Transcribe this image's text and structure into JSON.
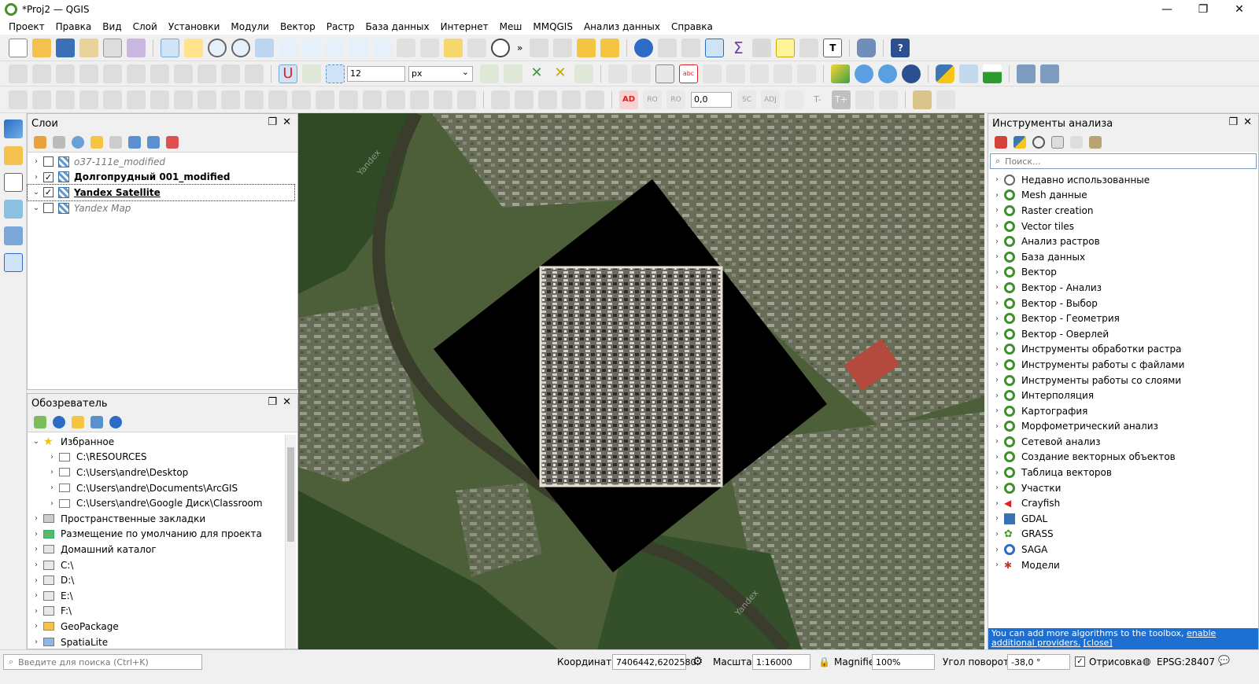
{
  "window": {
    "title": "*Proj2 — QGIS"
  },
  "menu": [
    "Проект",
    "Правка",
    "Вид",
    "Слой",
    "Установки",
    "Модули",
    "Вектор",
    "Растр",
    "База данных",
    "Интернет",
    "Меш",
    "MMQGIS",
    "Анализ данных",
    "Справка"
  ],
  "toolbar": {
    "snap_tolerance": "12",
    "snap_units": "px",
    "label_offset": "0,0"
  },
  "layers_panel": {
    "title": "Слои",
    "layers": [
      {
        "name": "o37-111e_modified",
        "checked": false,
        "expanded": false,
        "style": "italic-gray"
      },
      {
        "name": "Долгопрудный 001_modified",
        "checked": true,
        "expanded": false,
        "style": "bold"
      },
      {
        "name": "Yandex Satellite",
        "checked": true,
        "expanded": true,
        "style": "bold-underline"
      },
      {
        "name": "Yandex Map",
        "checked": false,
        "expanded": true,
        "style": "italic-gray"
      }
    ]
  },
  "browser_panel": {
    "title": "Обозреватель",
    "items": [
      {
        "label": "Избранное",
        "level": 0,
        "icon": "star-icon",
        "open": true
      },
      {
        "label": "C:\\RESOURCES",
        "level": 1,
        "icon": "folder-icon"
      },
      {
        "label": "C:\\Users\\andre\\Desktop",
        "level": 1,
        "icon": "folder-icon"
      },
      {
        "label": "C:\\Users\\andre\\Documents\\ArcGIS",
        "level": 1,
        "icon": "folder-icon"
      },
      {
        "label": "C:\\Users\\andre\\Google Диск\\Classroom",
        "level": 1,
        "icon": "folder-icon"
      },
      {
        "label": "Пространственные закладки",
        "level": 0,
        "icon": "bookmark-icon"
      },
      {
        "label": "Размещение по умолчанию для проекта",
        "level": 0,
        "icon": "project-home-icon"
      },
      {
        "label": "Домашний каталог",
        "level": 0,
        "icon": "home-icon"
      },
      {
        "label": "C:\\",
        "level": 0,
        "icon": "drive-icon"
      },
      {
        "label": "D:\\",
        "level": 0,
        "icon": "drive-icon"
      },
      {
        "label": "E:\\",
        "level": 0,
        "icon": "drive-icon"
      },
      {
        "label": "F:\\",
        "level": 0,
        "icon": "drive-icon"
      },
      {
        "label": "GeoPackage",
        "level": 0,
        "icon": "geopackage-icon"
      },
      {
        "label": "SpatiaLite",
        "level": 0,
        "icon": "spatialite-icon"
      }
    ]
  },
  "processing_panel": {
    "title": "Инструменты анализа",
    "search_placeholder": "Поиск...",
    "items": [
      {
        "label": "Недавно использованные",
        "icon": "clock-icon"
      },
      {
        "label": "Mesh данные",
        "icon": "qgis-icon"
      },
      {
        "label": "Raster creation",
        "icon": "qgis-icon"
      },
      {
        "label": "Vector tiles",
        "icon": "qgis-icon"
      },
      {
        "label": "Анализ растров",
        "icon": "qgis-icon"
      },
      {
        "label": "База данных",
        "icon": "qgis-icon"
      },
      {
        "label": "Вектор",
        "icon": "qgis-icon"
      },
      {
        "label": "Вектор - Анализ",
        "icon": "qgis-icon"
      },
      {
        "label": "Вектор - Выбор",
        "icon": "qgis-icon"
      },
      {
        "label": "Вектор - Геометрия",
        "icon": "qgis-icon"
      },
      {
        "label": "Вектор - Оверлей",
        "icon": "qgis-icon"
      },
      {
        "label": "Инструменты обработки растра",
        "icon": "qgis-icon"
      },
      {
        "label": "Инструменты работы с файлами",
        "icon": "qgis-icon"
      },
      {
        "label": "Инструменты работы со слоями",
        "icon": "qgis-icon"
      },
      {
        "label": "Интерполяция",
        "icon": "qgis-icon"
      },
      {
        "label": "Картография",
        "icon": "qgis-icon"
      },
      {
        "label": "Морфометрический анализ",
        "icon": "qgis-icon"
      },
      {
        "label": "Сетевой анализ",
        "icon": "qgis-icon"
      },
      {
        "label": "Создание векторных объектов",
        "icon": "qgis-icon"
      },
      {
        "label": "Таблица векторов",
        "icon": "qgis-icon"
      },
      {
        "label": "Участки",
        "icon": "qgis-icon"
      },
      {
        "label": "Crayfish",
        "icon": "crayfish-icon"
      },
      {
        "label": "GDAL",
        "icon": "gdal-icon"
      },
      {
        "label": "GRASS",
        "icon": "grass-icon"
      },
      {
        "label": "SAGA",
        "icon": "saga-icon"
      },
      {
        "label": "Модели",
        "icon": "models-icon"
      }
    ],
    "notice": {
      "text": "You can add more algorithms to the toolbox,",
      "link": "enable additional providers.",
      "close": "[close]"
    }
  },
  "map": {
    "watermark": "Yandex"
  },
  "status": {
    "search_placeholder": "Введите для поиска (Ctrl+K)",
    "coords_label": "Координаты",
    "coords_value": "7406442,6202580",
    "scale_label": "Масштаб",
    "scale_value": "1:16000",
    "magnifier_label": "Magnifier",
    "magnifier_value": "100%",
    "rotation_label": "Угол поворота",
    "rotation_value": "-38,0 °",
    "render_label": "Отрисовка",
    "crs": "EPSG:28407"
  },
  "colors": {
    "panel_bg": "#f0f0f0",
    "notice_bg": "#1e6fd2",
    "qgis_green": "#3f8f2a"
  }
}
